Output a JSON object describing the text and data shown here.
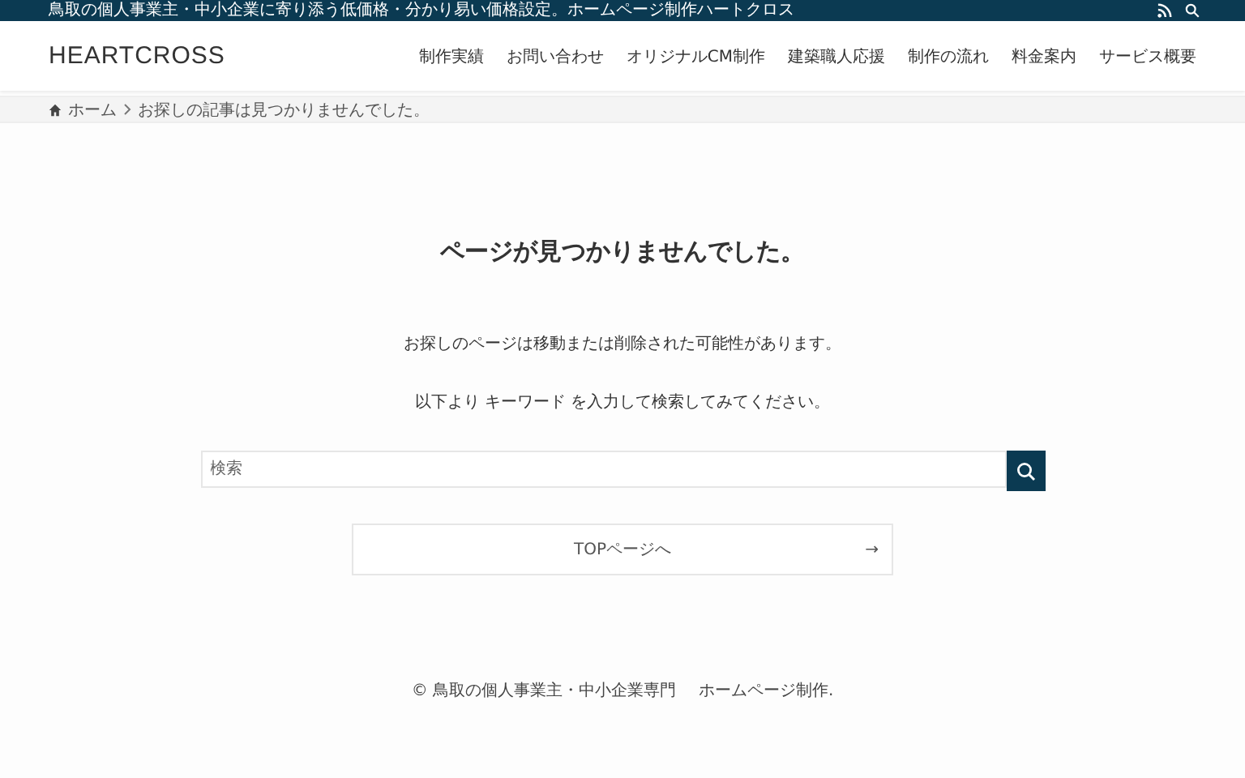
{
  "top_bar": {
    "tagline": "鳥取の個人事業主・中小企業に寄り添う低価格・分かり易い価格設定。ホームページ制作ハートクロス"
  },
  "header": {
    "logo": "HEARTCROSS",
    "nav": [
      "制作実績",
      "お問い合わせ",
      "オリジナルCM制作",
      "建築職人応援",
      "制作の流れ",
      "料金案内",
      "サービス概要"
    ]
  },
  "breadcrumb": [
    "ホーム",
    "お探しの記事は見つかりませんでした。"
  ],
  "main": {
    "title": "ページが見つかりませんでした。",
    "messages": [
      "お探しのページは移動または削除された可能性があります。",
      "以下より キーワード を入力して検索してみてください。"
    ],
    "search": {
      "placeholder": "検索"
    },
    "top_button": {
      "label": "TOPページへ",
      "arrow": "→"
    }
  },
  "footer": {
    "texts": [
      "© 鳥取の個人事業主・中小企業専門",
      "ホームページ制作."
    ]
  }
}
